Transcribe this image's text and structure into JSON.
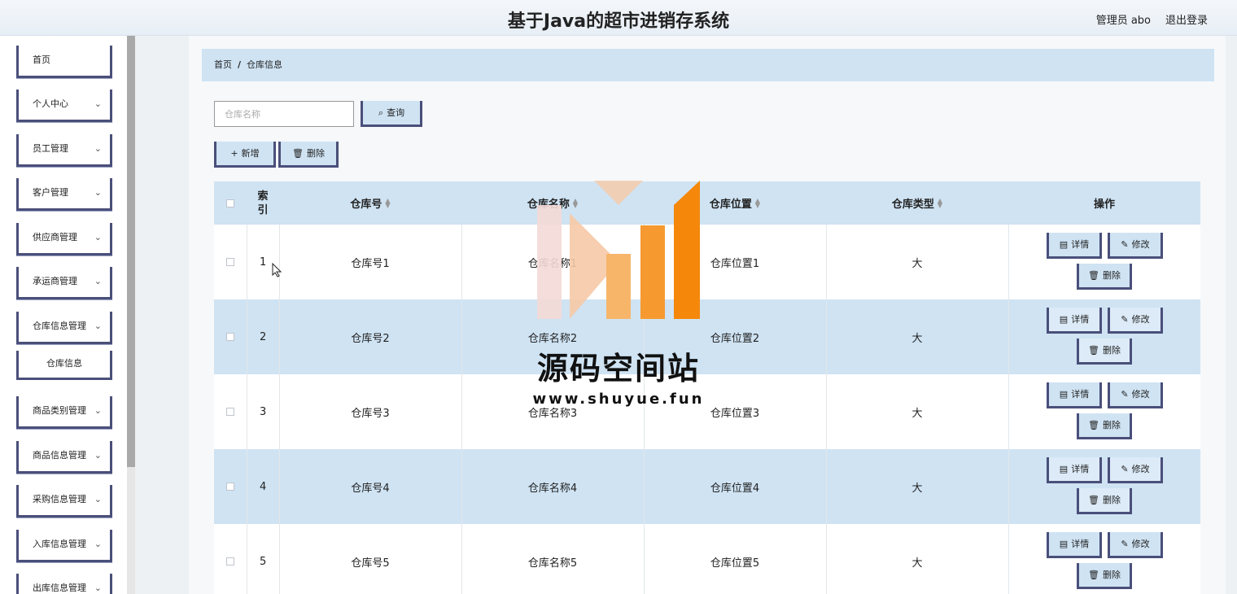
{
  "header": {
    "title": "基于Java的超市进销存系统",
    "user": "管理员 abo",
    "logout": "退出登录"
  },
  "sidebar": {
    "items": [
      {
        "label": "首页",
        "chev": ""
      },
      {
        "label": "个人中心",
        "chev": "⌄"
      },
      {
        "label": "员工管理",
        "chev": "⌄"
      },
      {
        "label": "客户管理",
        "chev": "⌄"
      },
      {
        "label": "供应商管理",
        "chev": "⌄"
      },
      {
        "label": "承运商管理",
        "chev": "⌄"
      },
      {
        "label": "仓库信息管理",
        "chev": "⌄"
      },
      {
        "label": "商品类别管理",
        "chev": "⌄"
      },
      {
        "label": "商品信息管理",
        "chev": "⌄"
      },
      {
        "label": "采购信息管理",
        "chev": "⌄"
      },
      {
        "label": "入库信息管理",
        "chev": "⌄"
      },
      {
        "label": "出库信息管理",
        "chev": "⌄"
      }
    ],
    "sub_item": "仓库信息"
  },
  "breadcrumb": {
    "home": "首页",
    "sep": "/",
    "current": "仓库信息"
  },
  "search": {
    "placeholder": "仓库名称",
    "button": "查询",
    "button_icon": "⌕"
  },
  "toolbar": {
    "add_icon": "+",
    "add": "新增",
    "delete_icon": "🗑",
    "delete": "删除"
  },
  "table": {
    "headers": {
      "index": "索\n引",
      "no": "仓库号",
      "name": "仓库名称",
      "location": "仓库位置",
      "type": "仓库类型",
      "ops": "操作"
    },
    "rows": [
      {
        "index": "1",
        "no": "仓库号1",
        "name": "仓库名称1",
        "location": "仓库位置1",
        "type": "大"
      },
      {
        "index": "2",
        "no": "仓库号2",
        "name": "仓库名称2",
        "location": "仓库位置2",
        "type": "大"
      },
      {
        "index": "3",
        "no": "仓库号3",
        "name": "仓库名称3",
        "location": "仓库位置3",
        "type": "大"
      },
      {
        "index": "4",
        "no": "仓库号4",
        "name": "仓库名称4",
        "location": "仓库位置4",
        "type": "大"
      },
      {
        "index": "5",
        "no": "仓库号5",
        "name": "仓库名称5",
        "location": "仓库位置5",
        "type": "大"
      }
    ],
    "ops": {
      "detail": "详情",
      "edit": "修改",
      "delete": "删除",
      "detail_icon": "▤",
      "edit_icon": "✎",
      "delete_icon": "🗑"
    }
  },
  "watermark": {
    "title": "源码空间站",
    "url": "www.shuyue.fun"
  },
  "colors": {
    "accent": "#4a4f7a",
    "row_highlight": "#cfe3f3",
    "bar_orange": "#f5870a"
  }
}
